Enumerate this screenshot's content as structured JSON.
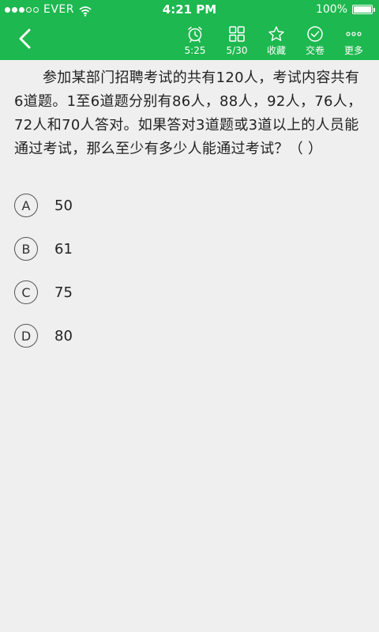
{
  "status_bar": {
    "carrier": "EVER",
    "time": "4:21 PM",
    "battery": "100%",
    "signal_bars_filled": 3,
    "signal_bars_total": 5
  },
  "header": {
    "accent_color": "#1db84f",
    "back_icon": "chevron-left-icon",
    "tools": [
      {
        "icon": "alarm-clock-icon",
        "label": "5:25"
      },
      {
        "icon": "grid-icon",
        "label": "5/30"
      },
      {
        "icon": "star-icon",
        "label": "收藏"
      },
      {
        "icon": "check-circle-icon",
        "label": "交卷"
      },
      {
        "icon": "more-dots-icon",
        "label": "更多"
      }
    ]
  },
  "question": {
    "text": "参加某部门招聘考试的共有120人，考试内容共有6道题。1至6道题分别有86人，88人，92人，76人，72人和70人答对。如果答对3道题或3道以上的人员能通过考试，那么至少有多少人能通过考试？（   ）"
  },
  "options": [
    {
      "letter": "A",
      "value": "50"
    },
    {
      "letter": "B",
      "value": "61"
    },
    {
      "letter": "C",
      "value": "75"
    },
    {
      "letter": "D",
      "value": "80"
    }
  ]
}
